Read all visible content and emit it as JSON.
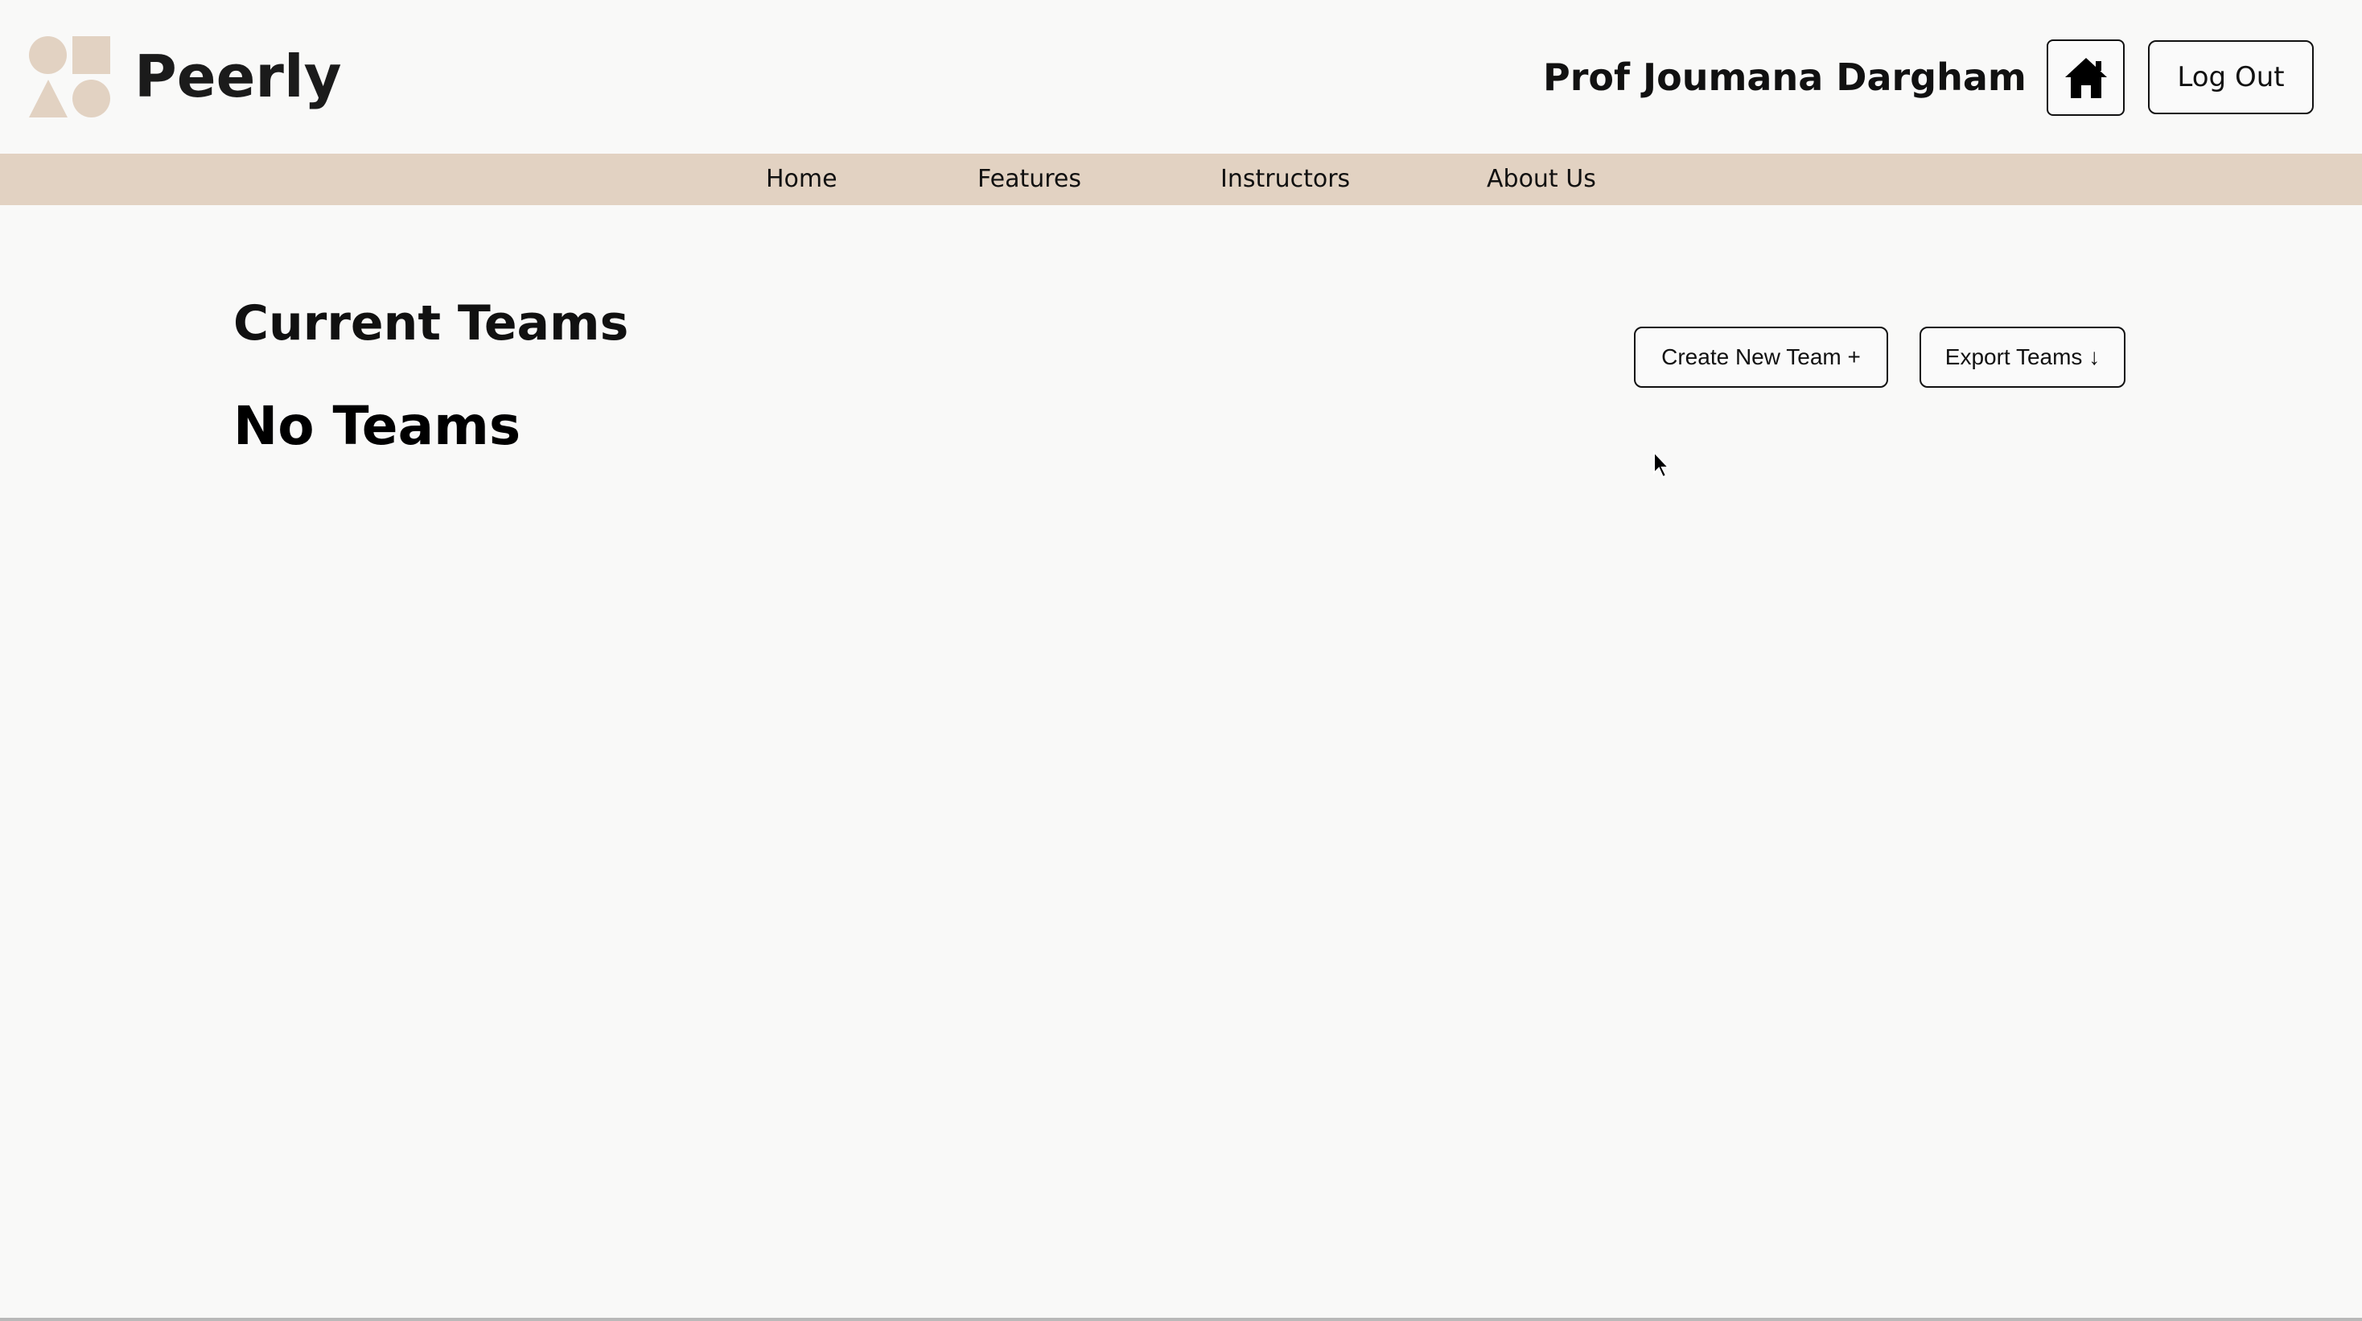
{
  "header": {
    "brand": "Peerly",
    "user_name": "Prof Joumana Dargham",
    "logout_label": "Log Out",
    "home_icon": "home-icon"
  },
  "nav": {
    "items": [
      {
        "label": "Home"
      },
      {
        "label": "Features"
      },
      {
        "label": "Instructors"
      },
      {
        "label": "About Us"
      }
    ]
  },
  "main": {
    "title": "Current Teams",
    "empty_state": "No Teams",
    "create_label": "Create New Team +",
    "export_label": "Export Teams ↓"
  },
  "colors": {
    "accent": "#e2d2c2",
    "background": "#f9f9f8",
    "text": "#111111"
  }
}
